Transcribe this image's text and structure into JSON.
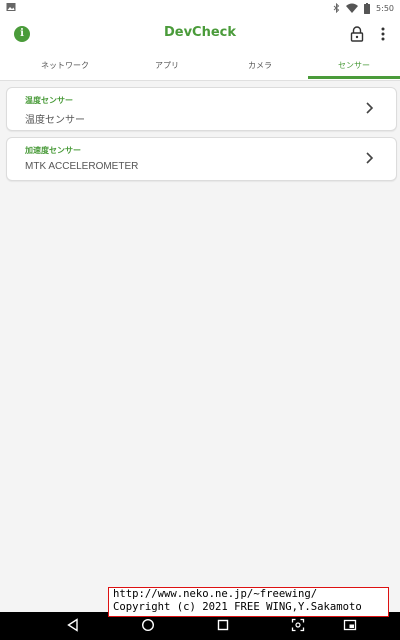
{
  "status": {
    "time": "5:50",
    "icons": [
      "image-icon",
      "bluetooth-icon",
      "wifi-icon",
      "battery-icon"
    ]
  },
  "appbar": {
    "title": "DevCheck",
    "icons": [
      "info-icon",
      "lock-icon",
      "overflow-menu-icon"
    ],
    "info_glyph": "i"
  },
  "tabs": [
    {
      "label": "ネットワーク",
      "active": false
    },
    {
      "label": "アプリ",
      "active": false
    },
    {
      "label": "カメラ",
      "active": false
    },
    {
      "label": "センサー",
      "active": true
    }
  ],
  "sensors": [
    {
      "title": "温度センサー",
      "value": "温度センサー"
    },
    {
      "title": "加速度センサー",
      "value": "MTK ACCELEROMETER"
    }
  ],
  "watermark": {
    "url": "http://www.neko.ne.jp/~freewing/",
    "copyright": "Copyright (c) 2021 FREE WING,Y.Sakamoto"
  },
  "navigation": {
    "icons": [
      "back-icon",
      "home-icon",
      "recents-icon",
      "screenshot-icon",
      "window-icon"
    ]
  },
  "colors": {
    "accent": "#4a9b3a",
    "background": "#f4f4f4",
    "card": "#ffffff",
    "navbar": "#000000"
  }
}
